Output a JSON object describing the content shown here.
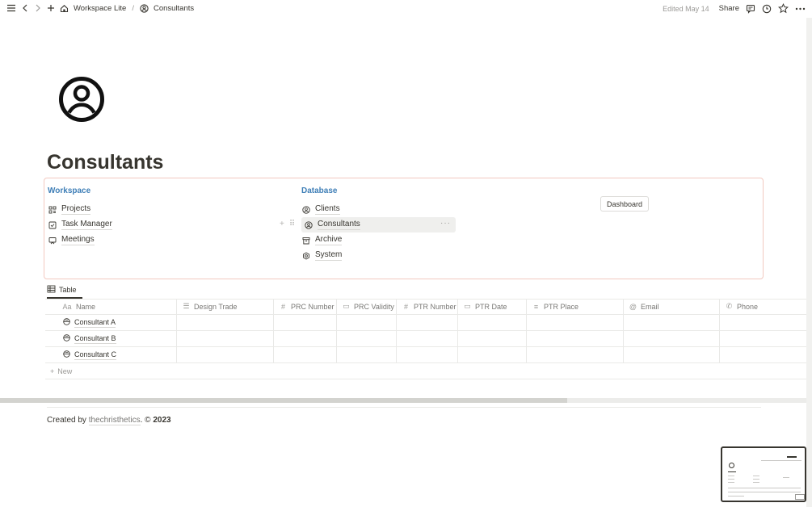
{
  "topbar": {
    "breadcrumb": [
      {
        "label": "Workspace Lite",
        "icon": "home-icon"
      },
      {
        "label": "Consultants",
        "icon": "user-circle-icon"
      }
    ],
    "separator": "/",
    "edited": "Edited May 14",
    "share_label": "Share"
  },
  "page": {
    "title": "Consultants",
    "icon": "user-circle-icon"
  },
  "nav": {
    "workspace": {
      "heading": "Workspace",
      "items": [
        {
          "label": "Projects",
          "icon": "grid-icon"
        },
        {
          "label": "Task Manager",
          "icon": "checkbox-icon"
        },
        {
          "label": "Meetings",
          "icon": "presentation-icon"
        }
      ]
    },
    "database": {
      "heading": "Database",
      "items": [
        {
          "label": "Clients",
          "icon": "user-circle-icon"
        },
        {
          "label": "Consultants",
          "icon": "user-circle-icon"
        },
        {
          "label": "Archive",
          "icon": "archive-icon"
        },
        {
          "label": "System",
          "icon": "gear-icon"
        }
      ]
    },
    "dashboard_label": "Dashboard",
    "more_label": "···"
  },
  "view": {
    "tab_label": "Table"
  },
  "table": {
    "columns": [
      {
        "label": "Name",
        "icon_text": "Aa"
      },
      {
        "label": "Design Trade",
        "icon_text": "☰"
      },
      {
        "label": "PRC Number",
        "icon_text": "#"
      },
      {
        "label": "PRC Validity",
        "icon_text": "▭"
      },
      {
        "label": "PTR Number",
        "icon_text": "#"
      },
      {
        "label": "PTR Date",
        "icon_text": "▭"
      },
      {
        "label": "PTR Place",
        "icon_text": "≡"
      },
      {
        "label": "Email",
        "icon_text": "@"
      },
      {
        "label": "Phone",
        "icon_text": "✆"
      }
    ],
    "rows": [
      {
        "name": "Consultant A"
      },
      {
        "name": "Consultant B"
      },
      {
        "name": "Consultant C"
      }
    ],
    "new_label": "New"
  },
  "footer": {
    "prefix": "Created by ",
    "link": "thechristhetics",
    "suffix": ". © ",
    "year": "2023"
  },
  "colors": {
    "text": "#37352f",
    "heading_blue": "#3f7fb7",
    "callout_border": "#f2c9c0",
    "muted": "#9b9a97"
  }
}
